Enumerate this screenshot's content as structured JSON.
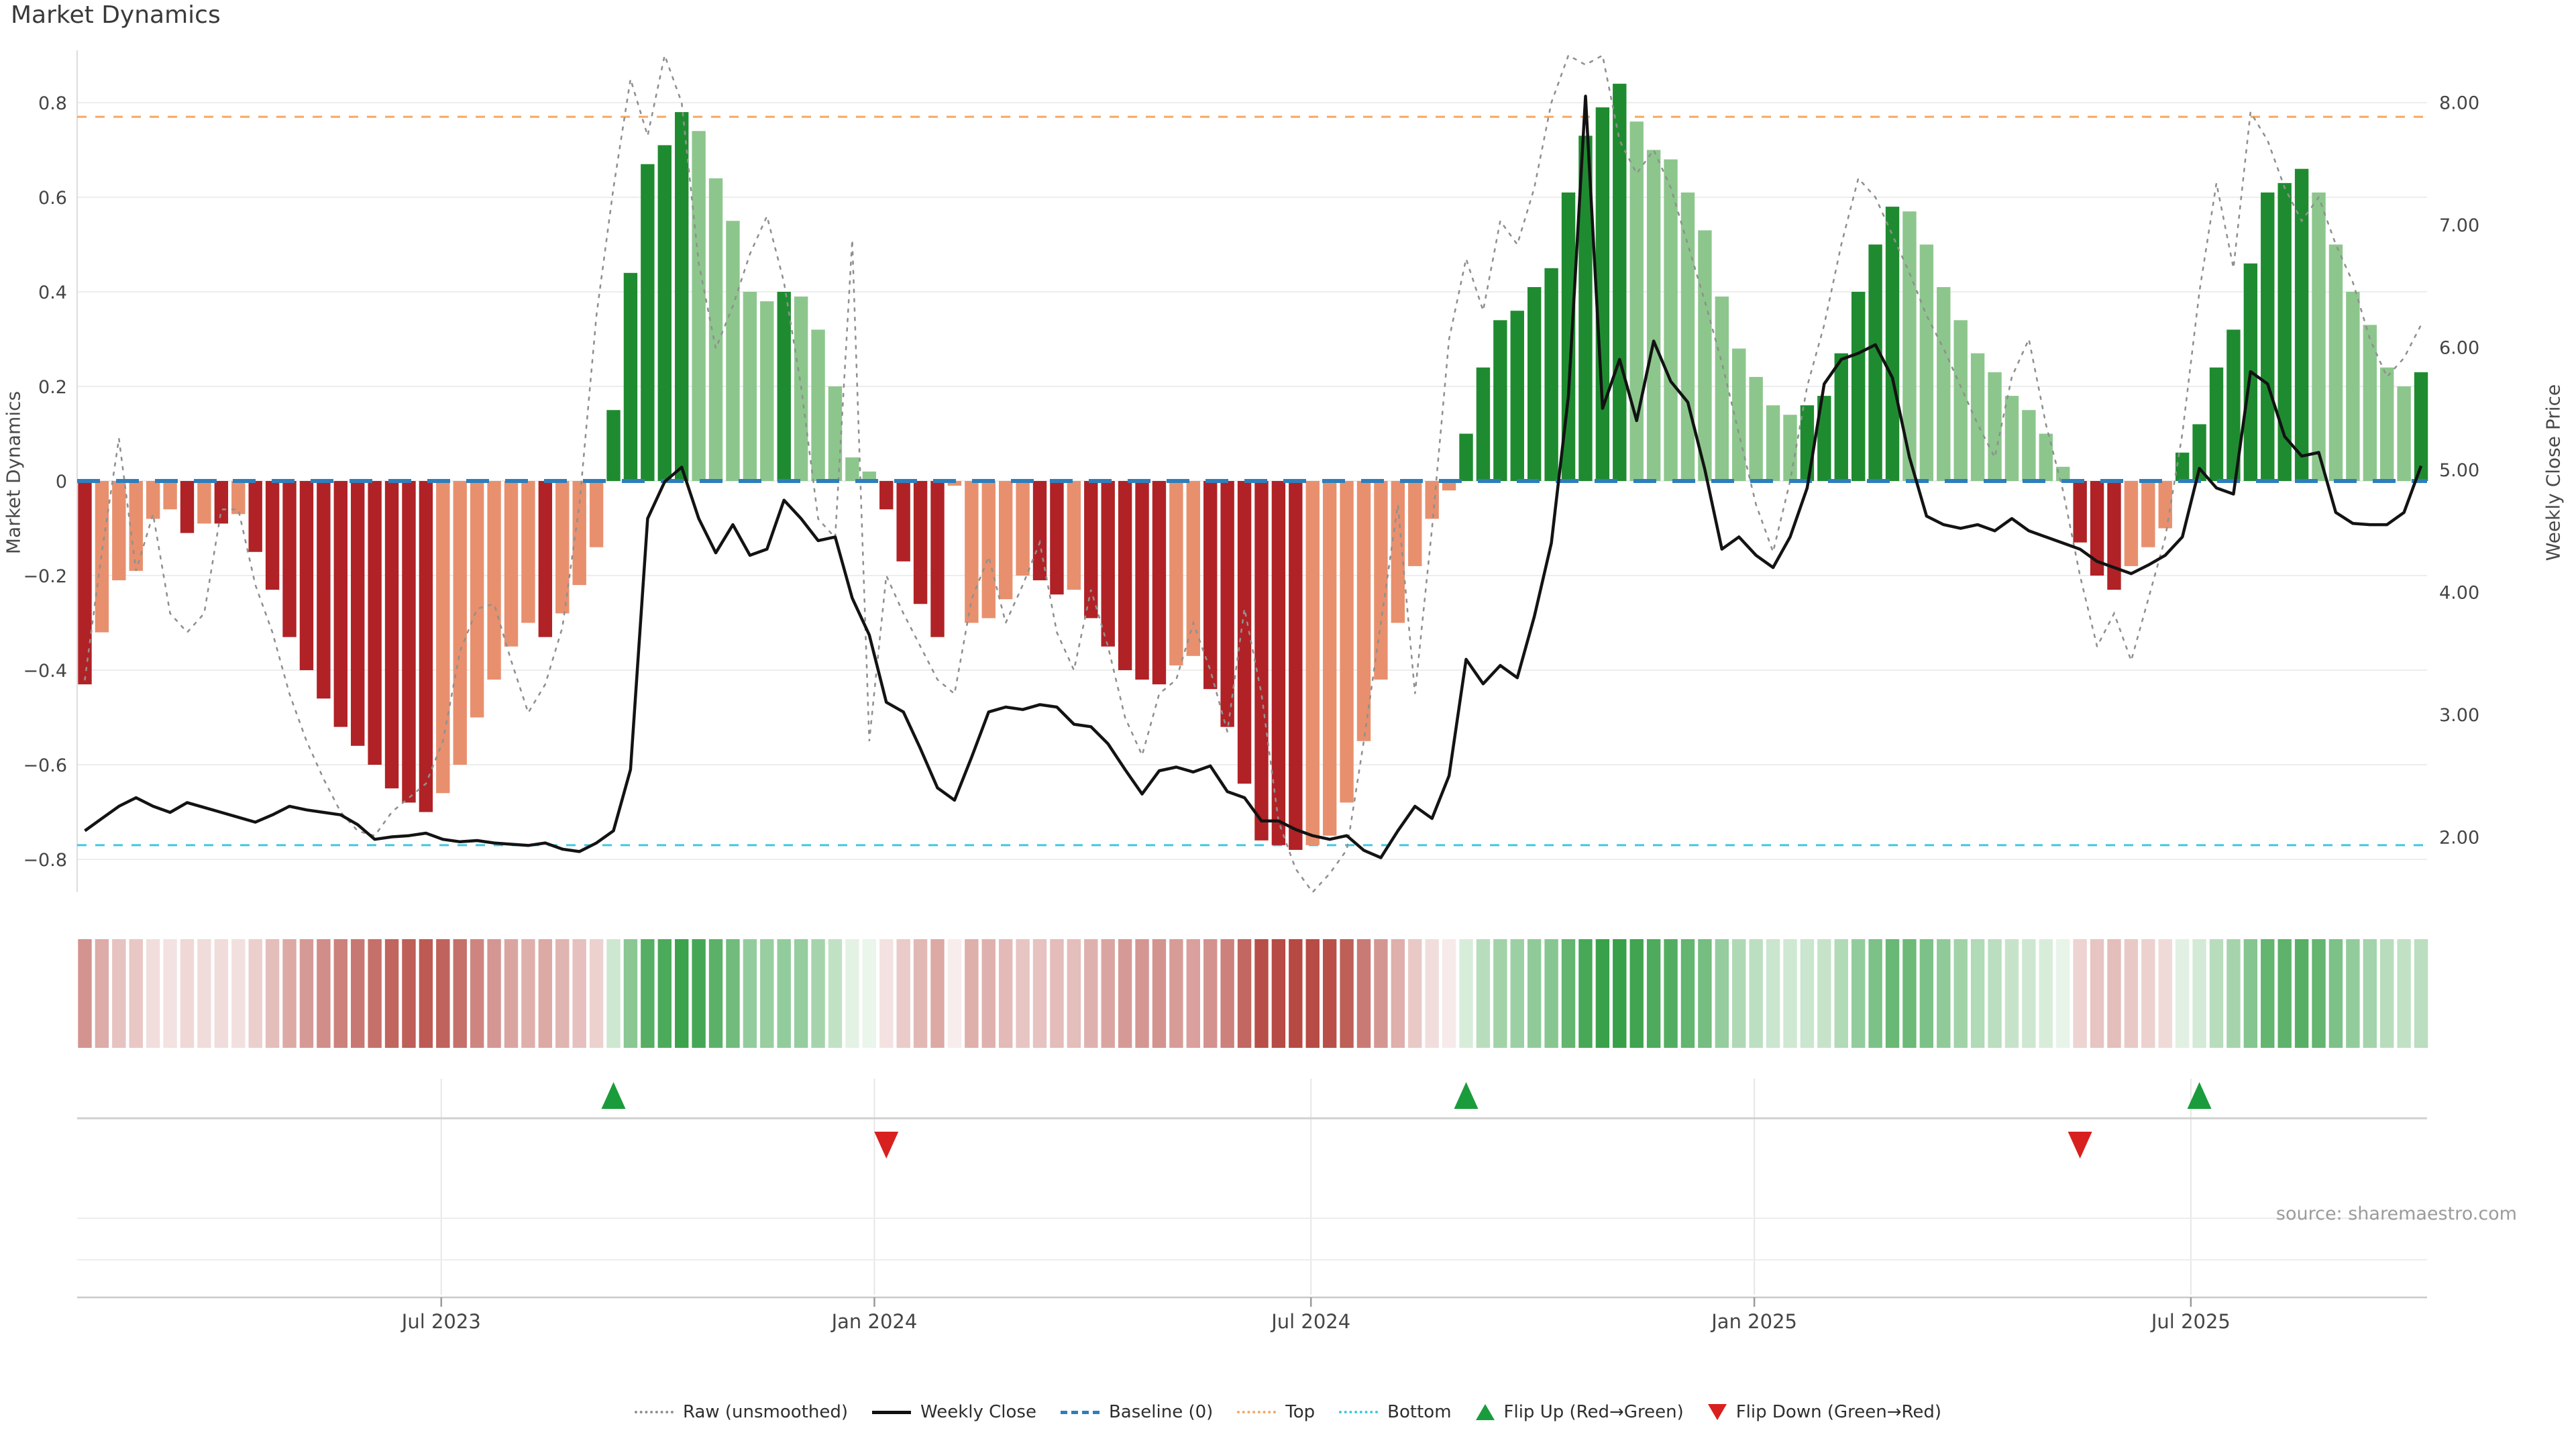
{
  "title": "Market Dynamics",
  "source": "source: sharemaestro.com",
  "axes": {
    "left_label": "Market Dynamics",
    "right_label": "Weekly Close Price",
    "left_ticks": [
      {
        "label": "0.8",
        "value": 0.8
      },
      {
        "label": "0.6",
        "value": 0.6
      },
      {
        "label": "0.4",
        "value": 0.4
      },
      {
        "label": "0.2",
        "value": 0.2
      },
      {
        "label": "0",
        "value": 0
      },
      {
        "label": "−0.2",
        "value": -0.2
      },
      {
        "label": "−0.4",
        "value": -0.4
      },
      {
        "label": "−0.6",
        "value": -0.6
      },
      {
        "label": "−0.8",
        "value": -0.8
      }
    ],
    "right_ticks": [
      {
        "label": "8.00",
        "value": 8
      },
      {
        "label": "7.00",
        "value": 7
      },
      {
        "label": "6.00",
        "value": 6
      },
      {
        "label": "5.00",
        "value": 5
      },
      {
        "label": "4.00",
        "value": 4
      },
      {
        "label": "3.00",
        "value": 3
      },
      {
        "label": "2.00",
        "value": 2
      }
    ],
    "x_ticks": [
      {
        "label": "Jul 2023",
        "week": 20.9
      },
      {
        "label": "Jan 2024",
        "week": 46.3
      },
      {
        "label": "Jul 2024",
        "week": 71.9
      },
      {
        "label": "Jan 2025",
        "week": 97.9
      },
      {
        "label": "Jul 2025",
        "week": 123.5
      }
    ]
  },
  "legend": [
    {
      "label": "Raw (unsmoothed)",
      "swatch": "dotted",
      "color": "#909090"
    },
    {
      "label": "Weekly Close",
      "swatch": "solid",
      "color": "#111111"
    },
    {
      "label": "Baseline (0)",
      "swatch": "dashed",
      "color": "#2e7ebc"
    },
    {
      "label": "Top",
      "swatch": "dotted",
      "color": "#f5a962"
    },
    {
      "label": "Bottom",
      "swatch": "dotted",
      "color": "#40c8e0"
    },
    {
      "label": "Flip Up (Red→Green)",
      "swatch": "triangle-up",
      "color": "#1a9c3c"
    },
    {
      "label": "Flip Down (Green→Red)",
      "swatch": "triangle-down",
      "color": "#d8201f"
    }
  ],
  "colors": {
    "bar_dark_red": "#b02226",
    "bar_light_red": "#e8906e",
    "bar_dark_green": "#1f8b30",
    "bar_light_green": "#8dc68d",
    "baseline": "#2e7ebc",
    "top_line": "#f5a962",
    "bottom_line": "#40c8e0",
    "raw_line": "#909090",
    "close_line": "#131313",
    "grid": "#ededed",
    "spine": "#dddddd",
    "tick_text": "#454545",
    "heat_red": "#b4453e",
    "heat_red_pale": "#f8efee",
    "heat_green": "#37a048",
    "heat_green_pale": "#eff7ef",
    "flip_up": "#1a9c3c",
    "flip_down": "#d8201f",
    "panel_line": "#d0d0d0",
    "panel_grid": "#e6e6e6",
    "axis_line": "#c9c9c9"
  },
  "chart_data": {
    "type": "bar",
    "description": "Weekly market-dynamics oscillator (left axis, bars + raw dotted line) with weekly close price (right axis, black line). Weeks span Feb 2023 - Sep 2025.",
    "left_axis_range": [
      -0.9,
      0.91
    ],
    "right_axis_range": [
      1.55,
      8.42
    ],
    "baseline": 0,
    "top_threshold": 0.77,
    "bottom_threshold": -0.77,
    "flip_up_weeks": [
      31,
      81,
      124
    ],
    "flip_down_weeks": [
      47,
      117
    ],
    "bar_shades": "DLLLLLDLDLDDDDDDDDDDDLLLLLLDLLLDDDDDLLLLLDLLLLLDDDDLLLLLDDLDDDDDLLDDDDDDLLLLLLLLLDDDDDDDDDDLLLLLLLLLLDDDDDDLLLLLLLLLLDDDLLLDDDDDDDDLLLLLLD",
    "series": [
      {
        "name": "Market Dynamics (smoothed)",
        "type": "bar",
        "axis": "left",
        "values": [
          -0.43,
          -0.32,
          -0.21,
          -0.19,
          -0.08,
          -0.06,
          -0.11,
          -0.09,
          -0.09,
          -0.07,
          -0.15,
          -0.23,
          -0.33,
          -0.4,
          -0.46,
          -0.52,
          -0.56,
          -0.6,
          -0.65,
          -0.68,
          -0.7,
          -0.66,
          -0.6,
          -0.5,
          -0.42,
          -0.35,
          -0.3,
          -0.33,
          -0.28,
          -0.22,
          -0.14,
          0.15,
          0.44,
          0.67,
          0.71,
          0.78,
          0.74,
          0.64,
          0.55,
          0.4,
          0.38,
          0.4,
          0.39,
          0.32,
          0.2,
          0.05,
          0.02,
          -0.06,
          -0.17,
          -0.26,
          -0.33,
          -0.01,
          -0.3,
          -0.29,
          -0.25,
          -0.2,
          -0.21,
          -0.24,
          -0.23,
          -0.29,
          -0.35,
          -0.4,
          -0.42,
          -0.43,
          -0.39,
          -0.37,
          -0.44,
          -0.52,
          -0.64,
          -0.76,
          -0.77,
          -0.78,
          -0.77,
          -0.75,
          -0.68,
          -0.55,
          -0.42,
          -0.3,
          -0.18,
          -0.08,
          -0.02,
          0.1,
          0.24,
          0.34,
          0.36,
          0.41,
          0.45,
          0.61,
          0.73,
          0.79,
          0.84,
          0.76,
          0.7,
          0.68,
          0.61,
          0.53,
          0.39,
          0.28,
          0.22,
          0.16,
          0.14,
          0.16,
          0.18,
          0.27,
          0.4,
          0.5,
          0.58,
          0.57,
          0.5,
          0.41,
          0.34,
          0.27,
          0.23,
          0.18,
          0.15,
          0.1,
          0.03,
          -0.13,
          -0.2,
          -0.23,
          -0.18,
          -0.14,
          -0.1,
          0.06,
          0.12,
          0.24,
          0.32,
          0.46,
          0.61,
          0.63,
          0.66,
          0.61,
          0.5,
          0.4,
          0.33,
          0.24,
          0.2,
          0.23
        ]
      },
      {
        "name": "Raw (unsmoothed)",
        "type": "line",
        "style": "dotted",
        "axis": "left",
        "values": [
          -0.42,
          -0.15,
          0.09,
          -0.19,
          -0.07,
          -0.28,
          -0.32,
          -0.28,
          -0.06,
          -0.06,
          -0.22,
          -0.32,
          -0.45,
          -0.55,
          -0.63,
          -0.7,
          -0.74,
          -0.75,
          -0.7,
          -0.67,
          -0.64,
          -0.55,
          -0.36,
          -0.27,
          -0.26,
          -0.38,
          -0.49,
          -0.43,
          -0.31,
          -0.05,
          0.35,
          0.62,
          0.85,
          0.73,
          0.91,
          0.8,
          0.46,
          0.28,
          0.37,
          0.48,
          0.56,
          0.42,
          0.2,
          -0.08,
          -0.12,
          0.51,
          -0.55,
          -0.2,
          -0.28,
          -0.35,
          -0.42,
          -0.45,
          -0.25,
          -0.16,
          -0.3,
          -0.22,
          -0.13,
          -0.32,
          -0.4,
          -0.23,
          -0.35,
          -0.5,
          -0.58,
          -0.45,
          -0.42,
          -0.3,
          -0.4,
          -0.53,
          -0.27,
          -0.45,
          -0.72,
          -0.82,
          -0.87,
          -0.83,
          -0.78,
          -0.55,
          -0.3,
          -0.05,
          -0.45,
          -0.1,
          0.3,
          0.47,
          0.36,
          0.55,
          0.5,
          0.62,
          0.8,
          0.95,
          0.88,
          0.93,
          0.72,
          0.65,
          0.7,
          0.62,
          0.5,
          0.38,
          0.25,
          0.1,
          -0.05,
          -0.15,
          0.0,
          0.2,
          0.33,
          0.5,
          0.64,
          0.6,
          0.52,
          0.44,
          0.35,
          0.28,
          0.2,
          0.12,
          0.05,
          0.22,
          0.3,
          0.12,
          -0.02,
          -0.2,
          -0.35,
          -0.28,
          -0.38,
          -0.25,
          -0.12,
          0.1,
          0.4,
          0.63,
          0.45,
          0.78,
          0.72,
          0.62,
          0.55,
          0.6,
          0.5,
          0.42,
          0.3,
          0.22,
          0.26,
          0.33
        ]
      },
      {
        "name": "Weekly Close",
        "type": "line",
        "style": "solid",
        "axis": "right",
        "values": [
          2.05,
          2.15,
          2.25,
          2.32,
          2.25,
          2.2,
          2.28,
          2.24,
          2.2,
          2.16,
          2.12,
          2.18,
          2.25,
          2.22,
          2.2,
          2.18,
          2.1,
          1.98,
          2.0,
          2.01,
          2.03,
          1.98,
          1.96,
          1.97,
          1.95,
          1.94,
          1.93,
          1.95,
          1.9,
          1.88,
          1.95,
          2.05,
          2.55,
          4.6,
          4.9,
          5.02,
          4.6,
          4.32,
          4.55,
          4.3,
          4.35,
          4.75,
          4.6,
          4.42,
          4.45,
          3.95,
          3.65,
          3.1,
          3.02,
          2.72,
          2.4,
          2.3,
          2.65,
          3.02,
          3.06,
          3.04,
          3.08,
          3.06,
          2.92,
          2.9,
          2.76,
          2.55,
          2.35,
          2.54,
          2.57,
          2.53,
          2.58,
          2.37,
          2.32,
          2.13,
          2.13,
          2.06,
          2.01,
          1.98,
          2.01,
          1.89,
          1.83,
          2.05,
          2.25,
          2.15,
          2.5,
          3.45,
          3.25,
          3.4,
          3.3,
          3.8,
          4.4,
          5.6,
          8.05,
          5.5,
          5.9,
          5.4,
          6.05,
          5.72,
          5.55,
          5.0,
          4.35,
          4.45,
          4.3,
          4.2,
          4.45,
          4.85,
          5.7,
          5.9,
          5.95,
          6.02,
          5.75,
          5.1,
          4.62,
          4.55,
          4.52,
          4.55,
          4.5,
          4.6,
          4.5,
          4.45,
          4.4,
          4.35,
          4.25,
          4.2,
          4.15,
          4.22,
          4.3,
          4.45,
          5.01,
          4.85,
          4.8,
          5.8,
          5.7,
          5.27,
          5.11,
          5.14,
          4.65,
          4.56,
          4.55,
          4.55,
          4.65,
          5.03
        ]
      }
    ]
  }
}
